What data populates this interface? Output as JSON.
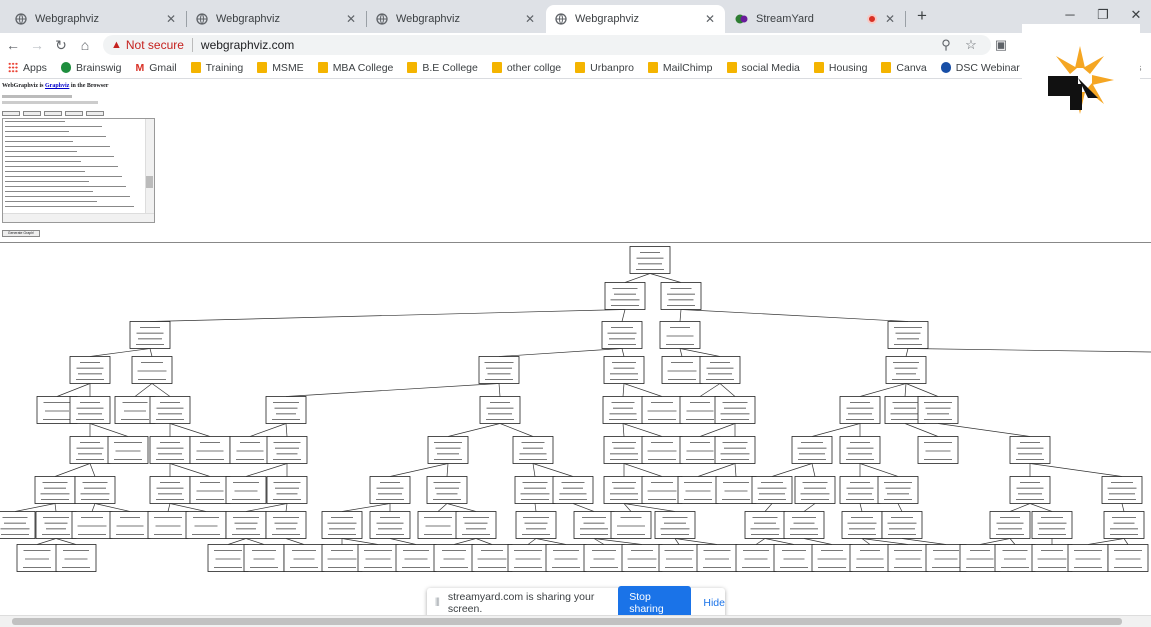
{
  "tabs": [
    {
      "title": "Webgraphviz"
    },
    {
      "title": "Webgraphviz"
    },
    {
      "title": "Webgraphviz"
    },
    {
      "title": "Webgraphviz"
    },
    {
      "title": "StreamYard"
    }
  ],
  "toolbar": {
    "security": "Not secure",
    "url": "webgraphviz.com"
  },
  "bookmarks": [
    {
      "label": "Apps",
      "icon": "apps-grid-icon"
    },
    {
      "label": "Brainswig",
      "icon": "brainswig-icon"
    },
    {
      "label": "Gmail",
      "icon": "gmail-icon"
    },
    {
      "label": "Training",
      "icon": "folder-icon"
    },
    {
      "label": "MSME",
      "icon": "folder-icon"
    },
    {
      "label": "MBA College",
      "icon": "folder-icon"
    },
    {
      "label": "B.E College",
      "icon": "folder-icon"
    },
    {
      "label": "other collge",
      "icon": "folder-icon"
    },
    {
      "label": "Urbanpro",
      "icon": "folder-icon"
    },
    {
      "label": "MailChimp",
      "icon": "folder-icon"
    },
    {
      "label": "social Media",
      "icon": "folder-icon"
    },
    {
      "label": "Housing",
      "icon": "folder-icon"
    },
    {
      "label": "Canva",
      "icon": "folder-icon"
    },
    {
      "label": "DSC Webinar Series...",
      "icon": "dsc-icon"
    },
    {
      "label": "ks",
      "icon": ""
    }
  ],
  "page": {
    "title_prefix": "WebGraphviz is ",
    "title_link": "Graphviz",
    "title_suffix": " in the Browser",
    "button": "Generate Graph!"
  },
  "share_bar": {
    "message": "streamyard.com is sharing your screen.",
    "stop": "Stop sharing",
    "hide": "Hide"
  },
  "colors": {
    "accent": "#1a73e8",
    "warning": "#c5221f",
    "folder": "#f4b400"
  }
}
